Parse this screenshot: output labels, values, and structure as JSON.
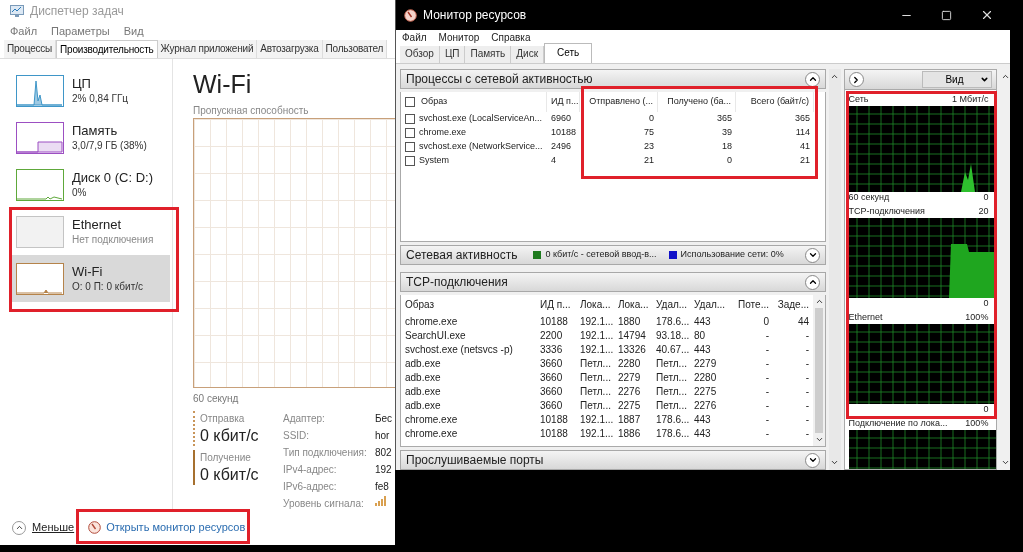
{
  "task_manager": {
    "title": "Диспетчер задач",
    "menu": [
      "Файл",
      "Параметры",
      "Вид"
    ],
    "tabs": [
      {
        "label": "Процессы",
        "selected": false
      },
      {
        "label": "Производительность",
        "selected": true
      },
      {
        "label": "Журнал приложений",
        "selected": false
      },
      {
        "label": "Автозагрузка",
        "selected": false
      },
      {
        "label": "Пользовател",
        "selected": false
      }
    ],
    "sidebar": [
      {
        "title": "ЦП",
        "subtitle": "2% 0,84 ГГц",
        "color": "#3f96c8",
        "kind": "spike",
        "selected": false
      },
      {
        "title": "Память",
        "subtitle": "3,0/7,9 ГБ (38%)",
        "color": "#9c4fc2",
        "kind": "step",
        "selected": false
      },
      {
        "title": "Диск 0 (C: D:)",
        "subtitle": "0%",
        "color": "#5ea83a",
        "kind": "flat",
        "selected": false
      },
      {
        "title": "Ethernet",
        "subtitle": "Нет подключения",
        "color": "#c4c4c4",
        "kind": "empty",
        "selected": false
      },
      {
        "title": "Wi-Fi",
        "subtitle": "О: 0 П: 0 кбит/с",
        "color": "#b5834a",
        "kind": "bump",
        "selected": true
      }
    ],
    "heading": "Wi-Fi",
    "graph_label": "Пропускная способность",
    "time_label": "60 секунд",
    "stats": [
      {
        "label": "Отправка",
        "value": "0 кбит/с",
        "kind": "dotted"
      },
      {
        "label": "Получение",
        "value": "0 кбит/с",
        "kind": "solid"
      }
    ],
    "properties": [
      {
        "label": "Адаптер:",
        "value": "Бес",
        "kind": "text"
      },
      {
        "label": "SSID:",
        "value": "hor",
        "kind": "text"
      },
      {
        "label": "Тип подключения:",
        "value": "802",
        "kind": "text"
      },
      {
        "label": "IPv4-адрес:",
        "value": "192",
        "kind": "text"
      },
      {
        "label": "IPv6-адрес:",
        "value": "fe8",
        "kind": "text"
      },
      {
        "label": "Уровень сигнала:",
        "kind": "signal"
      }
    ],
    "less": "Меньше",
    "open_link": "Открыть монитор ресурсов"
  },
  "resource_monitor": {
    "title": "Монитор ресурсов",
    "menu": [
      "Файл",
      "Монитор",
      "Справка"
    ],
    "tabs": [
      {
        "label": "Обзор",
        "selected": false
      },
      {
        "label": "ЦП",
        "selected": false
      },
      {
        "label": "Память",
        "selected": false
      },
      {
        "label": "Диск",
        "selected": false
      },
      {
        "label": "Сеть",
        "selected": true
      }
    ],
    "processes": {
      "title": "Процессы с сетевой активностью",
      "expanded": true,
      "all_checked": false,
      "columns": [
        "Образ",
        "ИД п...",
        "Отправлено (...",
        "Получено (ба...",
        "Всего (байт/с)"
      ],
      "rows": [
        {
          "checked": false,
          "cells": [
            "svchost.exe (LocalServiceAn...",
            "6960",
            "0",
            "365",
            "365"
          ]
        },
        {
          "checked": false,
          "cells": [
            "chrome.exe",
            "10188",
            "75",
            "39",
            "114"
          ]
        },
        {
          "checked": false,
          "cells": [
            "svchost.exe (NetworkService...",
            "2496",
            "23",
            "18",
            "41"
          ]
        },
        {
          "checked": false,
          "cells": [
            "System",
            "4",
            "21",
            "0",
            "21"
          ]
        }
      ]
    },
    "activity": {
      "title": "Сетевая активность",
      "expanded": false,
      "legend": [
        {
          "label": "0 кбит/с - сетевой ввод-в...",
          "color": "#1e7a1e"
        },
        {
          "label": "Использование сети: 0%",
          "color": "#1010c8"
        }
      ]
    },
    "tcp": {
      "title": "TCP-подключения",
      "expanded": true,
      "columns": [
        "Образ",
        "ИД п...",
        "Лока...",
        "Лока...",
        "Удал...",
        "Удал...",
        "Поте...",
        "Заде..."
      ],
      "rows": [
        [
          "chrome.exe",
          "10188",
          "192.1...",
          "1880",
          "178.6...",
          "443",
          "0",
          "44"
        ],
        [
          "SearchUI.exe",
          "2200",
          "192.1...",
          "14794",
          "93.18...",
          "80",
          "-",
          "-"
        ],
        [
          "svchost.exe (netsvcs -p)",
          "3336",
          "192.1...",
          "13326",
          "40.67...",
          "443",
          "-",
          "-"
        ],
        [
          "adb.exe",
          "3660",
          "Петл...",
          "2280",
          "Петл...",
          "2279",
          "-",
          "-"
        ],
        [
          "adb.exe",
          "3660",
          "Петл...",
          "2279",
          "Петл...",
          "2280",
          "-",
          "-"
        ],
        [
          "adb.exe",
          "3660",
          "Петл...",
          "2276",
          "Петл...",
          "2275",
          "-",
          "-"
        ],
        [
          "adb.exe",
          "3660",
          "Петл...",
          "2275",
          "Петл...",
          "2276",
          "-",
          "-"
        ],
        [
          "chrome.exe",
          "10188",
          "192.1...",
          "1887",
          "178.6...",
          "443",
          "-",
          "-"
        ],
        [
          "chrome.exe",
          "10188",
          "192.1...",
          "1886",
          "178.6...",
          "443",
          "-",
          "-"
        ]
      ]
    },
    "ports": {
      "title": "Прослушиваемые порты",
      "expanded": false
    },
    "view_button": "Вид",
    "graphs": [
      {
        "title": "Сеть",
        "max": "1 Мбит/с",
        "min": "0",
        "time_label": "60 секунд",
        "kind": "spikes"
      },
      {
        "title": "TCP-подключения",
        "max": "20",
        "min": "0",
        "kind": "step"
      },
      {
        "title": "Ethernet",
        "max": "100%",
        "min": "0",
        "kind": "flat"
      },
      {
        "title": "Подключение по лока...",
        "max": "100%",
        "kind": "flat"
      }
    ]
  }
}
